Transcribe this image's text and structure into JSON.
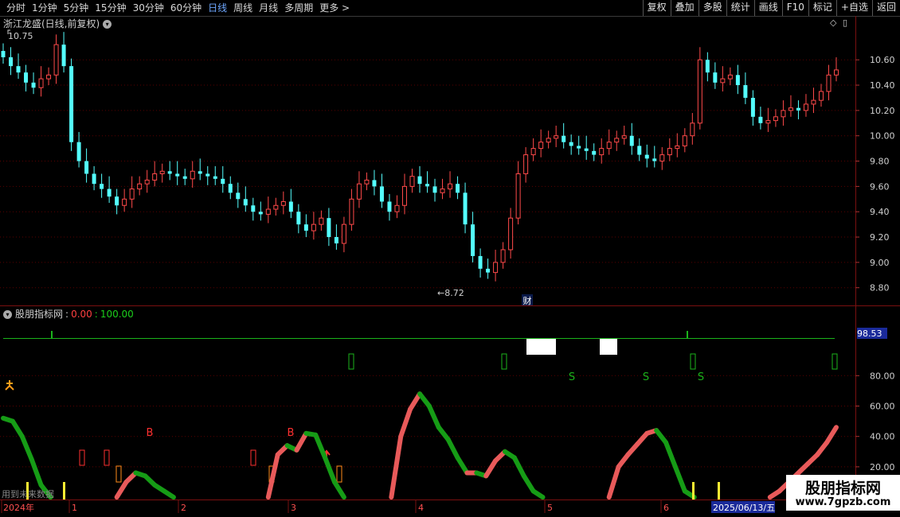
{
  "toolbar": {
    "periods": [
      "分时",
      "1分钟",
      "5分钟",
      "15分钟",
      "30分钟",
      "60分钟",
      "日线",
      "周线",
      "月线",
      "多周期",
      "更多 >"
    ],
    "active_period": "日线",
    "actions": [
      "复权",
      "叠加",
      "多股",
      "统计",
      "画线",
      "F10",
      "标记",
      "+自选",
      "返回"
    ]
  },
  "main_chart": {
    "title": "浙江龙盛(日线,前复权)",
    "high_label": "10.75",
    "low_label": "←8.72",
    "fin_marker": "财",
    "price_ticks": [
      "10.60",
      "10.40",
      "10.20",
      "10.00",
      "9.80",
      "9.60",
      "9.40",
      "9.20",
      "9.00",
      "8.80"
    ],
    "ylim": [
      8.66,
      10.84
    ]
  },
  "indicator": {
    "name": "股朋指标网",
    "value_a": "0.00",
    "separator": ":",
    "value_b": "100.00",
    "value_box": "98.53",
    "ticks": [
      "80.00",
      "60.00",
      "40.00",
      "20.00"
    ],
    "buy_label": "B",
    "sell_label": "S",
    "bottom_note": "用到未来数据"
  },
  "x_axis": {
    "labels": [
      "2024年",
      "1",
      "2",
      "3",
      "4",
      "5",
      "6"
    ],
    "cursor_date": "2025/06/13/五"
  },
  "watermark": {
    "line1": "股朋指标网",
    "line2": "www.7gpzb.com"
  },
  "colors": {
    "up": "#ff4a4a",
    "down": "#54ffff",
    "grid": "#5a0000",
    "green": "#1bb31b",
    "red_line": "#ff5f5f"
  },
  "chart_data": {
    "type": "candlestick",
    "series": [
      {
        "name": "price",
        "values": [
          10.62,
          10.55,
          10.5,
          10.42,
          10.38,
          10.45,
          10.48,
          10.72,
          10.55,
          9.95,
          9.8,
          9.7,
          9.62,
          9.58,
          9.52,
          9.45,
          9.5,
          9.58,
          9.62,
          9.65,
          9.7,
          9.72,
          9.7,
          9.68,
          9.66,
          9.72,
          9.7,
          9.68,
          9.66,
          9.62,
          9.55,
          9.5,
          9.45,
          9.4,
          9.38,
          9.42,
          9.45,
          9.48,
          9.4,
          9.3,
          9.25,
          9.3,
          9.35,
          9.2,
          9.15,
          9.3,
          9.5,
          9.62,
          9.65,
          9.6,
          9.48,
          9.4,
          9.45,
          9.6,
          9.68,
          9.62,
          9.6,
          9.55,
          9.58,
          9.62,
          9.55,
          9.3,
          9.05,
          8.95,
          8.92,
          9.0,
          9.1,
          9.35,
          9.7,
          9.85,
          9.9,
          9.95,
          9.98,
          10.0,
          9.95,
          9.92,
          9.9,
          9.88,
          9.85,
          9.9,
          9.95,
          9.98,
          10.0,
          9.92,
          9.85,
          9.82,
          9.8,
          9.85,
          9.9,
          9.92,
          10.0,
          10.1,
          10.6,
          10.5,
          10.42,
          10.45,
          10.48,
          10.4,
          10.3,
          10.15,
          10.1,
          10.12,
          10.15,
          10.2,
          10.22,
          10.2,
          10.25,
          10.28,
          10.35,
          10.48,
          10.52
        ]
      },
      {
        "name": "indicator",
        "values": [
          52,
          50,
          40,
          25,
          8,
          0,
          0,
          0,
          0,
          0,
          0,
          0,
          0,
          10,
          16,
          14,
          8,
          4,
          0,
          0,
          0,
          0,
          0,
          0,
          0,
          0,
          0,
          0,
          0,
          28,
          34,
          31,
          42,
          41,
          26,
          10,
          0,
          0,
          0,
          0,
          0,
          0,
          40,
          58,
          68,
          60,
          46,
          38,
          26,
          16,
          16,
          14,
          24,
          30,
          26,
          14,
          4,
          0,
          0,
          0,
          0,
          0,
          0,
          0,
          0,
          20,
          28,
          35,
          42,
          44,
          36,
          20,
          4,
          0,
          0,
          0,
          0,
          0,
          0,
          0,
          0,
          0,
          4,
          10,
          16,
          22,
          28,
          36,
          46
        ]
      }
    ]
  }
}
